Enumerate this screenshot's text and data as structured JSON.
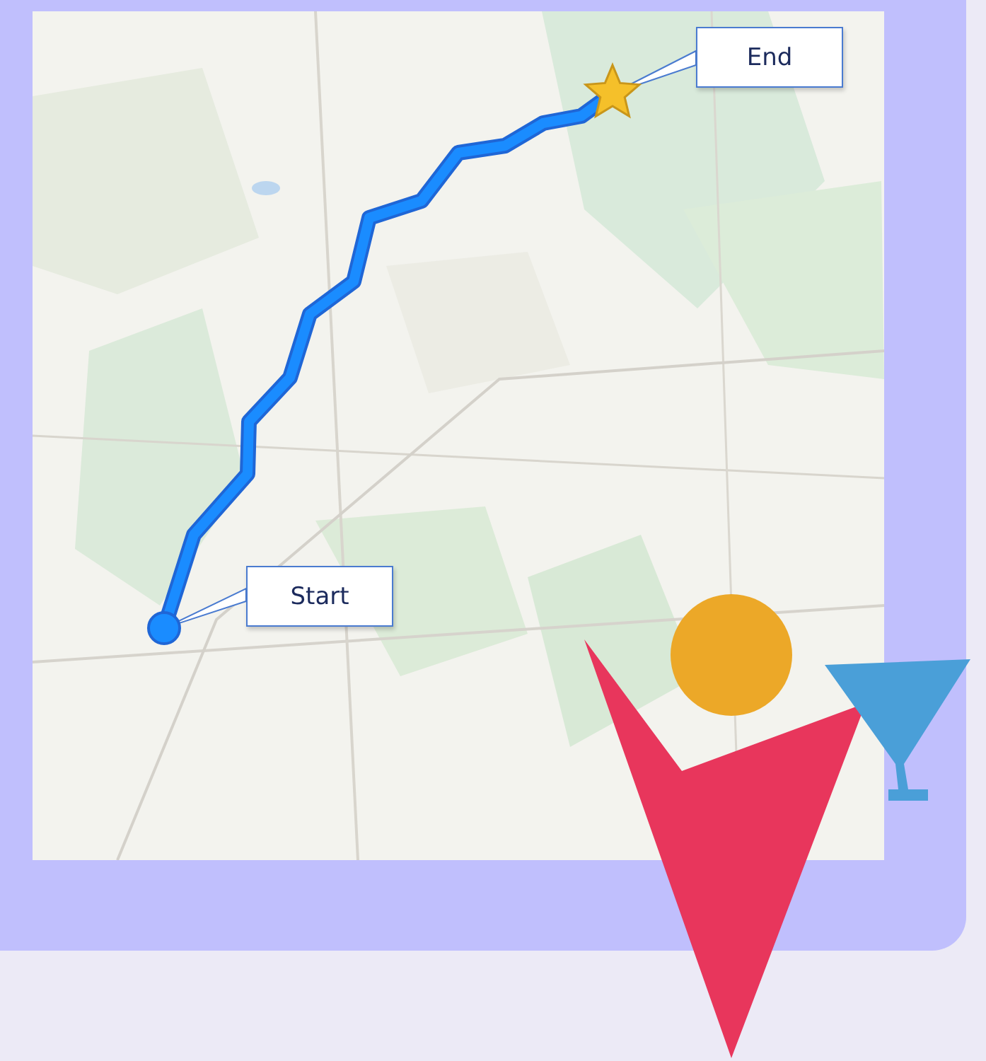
{
  "callouts": [
    {
      "kind": "start",
      "label": "Start"
    },
    {
      "kind": "end",
      "label": "End"
    }
  ]
}
